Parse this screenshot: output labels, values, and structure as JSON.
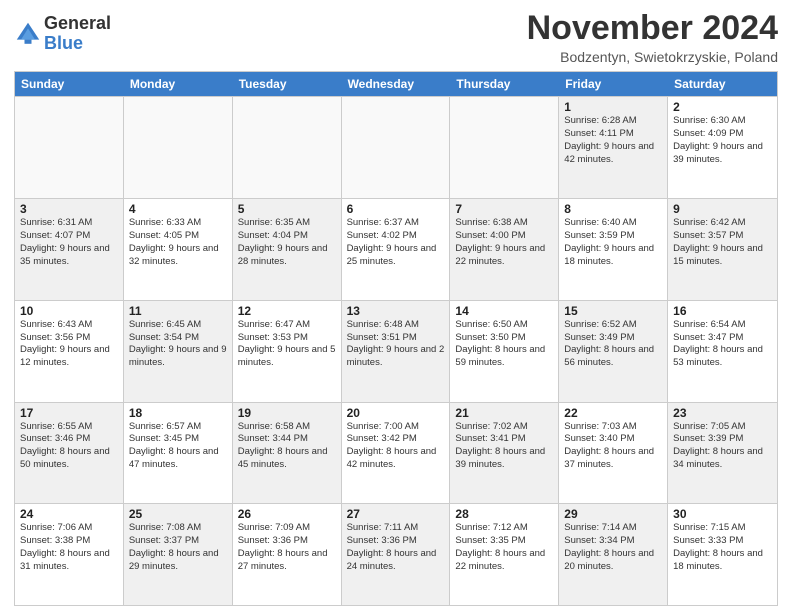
{
  "logo": {
    "general": "General",
    "blue": "Blue"
  },
  "title": "November 2024",
  "location": "Bodzentyn, Swietokrzyskie, Poland",
  "days_header": [
    "Sunday",
    "Monday",
    "Tuesday",
    "Wednesday",
    "Thursday",
    "Friday",
    "Saturday"
  ],
  "weeks": [
    [
      {
        "day": "",
        "info": "",
        "empty": true
      },
      {
        "day": "",
        "info": "",
        "empty": true
      },
      {
        "day": "",
        "info": "",
        "empty": true
      },
      {
        "day": "",
        "info": "",
        "empty": true
      },
      {
        "day": "",
        "info": "",
        "empty": true
      },
      {
        "day": "1",
        "info": "Sunrise: 6:28 AM\nSunset: 4:11 PM\nDaylight: 9 hours\nand 42 minutes.",
        "shaded": true
      },
      {
        "day": "2",
        "info": "Sunrise: 6:30 AM\nSunset: 4:09 PM\nDaylight: 9 hours\nand 39 minutes.",
        "shaded": false
      }
    ],
    [
      {
        "day": "3",
        "info": "Sunrise: 6:31 AM\nSunset: 4:07 PM\nDaylight: 9 hours\nand 35 minutes.",
        "shaded": true
      },
      {
        "day": "4",
        "info": "Sunrise: 6:33 AM\nSunset: 4:05 PM\nDaylight: 9 hours\nand 32 minutes.",
        "shaded": false
      },
      {
        "day": "5",
        "info": "Sunrise: 6:35 AM\nSunset: 4:04 PM\nDaylight: 9 hours\nand 28 minutes.",
        "shaded": true
      },
      {
        "day": "6",
        "info": "Sunrise: 6:37 AM\nSunset: 4:02 PM\nDaylight: 9 hours\nand 25 minutes.",
        "shaded": false
      },
      {
        "day": "7",
        "info": "Sunrise: 6:38 AM\nSunset: 4:00 PM\nDaylight: 9 hours\nand 22 minutes.",
        "shaded": true
      },
      {
        "day": "8",
        "info": "Sunrise: 6:40 AM\nSunset: 3:59 PM\nDaylight: 9 hours\nand 18 minutes.",
        "shaded": false
      },
      {
        "day": "9",
        "info": "Sunrise: 6:42 AM\nSunset: 3:57 PM\nDaylight: 9 hours\nand 15 minutes.",
        "shaded": true
      }
    ],
    [
      {
        "day": "10",
        "info": "Sunrise: 6:43 AM\nSunset: 3:56 PM\nDaylight: 9 hours\nand 12 minutes.",
        "shaded": false
      },
      {
        "day": "11",
        "info": "Sunrise: 6:45 AM\nSunset: 3:54 PM\nDaylight: 9 hours\nand 9 minutes.",
        "shaded": true
      },
      {
        "day": "12",
        "info": "Sunrise: 6:47 AM\nSunset: 3:53 PM\nDaylight: 9 hours\nand 5 minutes.",
        "shaded": false
      },
      {
        "day": "13",
        "info": "Sunrise: 6:48 AM\nSunset: 3:51 PM\nDaylight: 9 hours\nand 2 minutes.",
        "shaded": true
      },
      {
        "day": "14",
        "info": "Sunrise: 6:50 AM\nSunset: 3:50 PM\nDaylight: 8 hours\nand 59 minutes.",
        "shaded": false
      },
      {
        "day": "15",
        "info": "Sunrise: 6:52 AM\nSunset: 3:49 PM\nDaylight: 8 hours\nand 56 minutes.",
        "shaded": true
      },
      {
        "day": "16",
        "info": "Sunrise: 6:54 AM\nSunset: 3:47 PM\nDaylight: 8 hours\nand 53 minutes.",
        "shaded": false
      }
    ],
    [
      {
        "day": "17",
        "info": "Sunrise: 6:55 AM\nSunset: 3:46 PM\nDaylight: 8 hours\nand 50 minutes.",
        "shaded": true
      },
      {
        "day": "18",
        "info": "Sunrise: 6:57 AM\nSunset: 3:45 PM\nDaylight: 8 hours\nand 47 minutes.",
        "shaded": false
      },
      {
        "day": "19",
        "info": "Sunrise: 6:58 AM\nSunset: 3:44 PM\nDaylight: 8 hours\nand 45 minutes.",
        "shaded": true
      },
      {
        "day": "20",
        "info": "Sunrise: 7:00 AM\nSunset: 3:42 PM\nDaylight: 8 hours\nand 42 minutes.",
        "shaded": false
      },
      {
        "day": "21",
        "info": "Sunrise: 7:02 AM\nSunset: 3:41 PM\nDaylight: 8 hours\nand 39 minutes.",
        "shaded": true
      },
      {
        "day": "22",
        "info": "Sunrise: 7:03 AM\nSunset: 3:40 PM\nDaylight: 8 hours\nand 37 minutes.",
        "shaded": false
      },
      {
        "day": "23",
        "info": "Sunrise: 7:05 AM\nSunset: 3:39 PM\nDaylight: 8 hours\nand 34 minutes.",
        "shaded": true
      }
    ],
    [
      {
        "day": "24",
        "info": "Sunrise: 7:06 AM\nSunset: 3:38 PM\nDaylight: 8 hours\nand 31 minutes.",
        "shaded": false
      },
      {
        "day": "25",
        "info": "Sunrise: 7:08 AM\nSunset: 3:37 PM\nDaylight: 8 hours\nand 29 minutes.",
        "shaded": true
      },
      {
        "day": "26",
        "info": "Sunrise: 7:09 AM\nSunset: 3:36 PM\nDaylight: 8 hours\nand 27 minutes.",
        "shaded": false
      },
      {
        "day": "27",
        "info": "Sunrise: 7:11 AM\nSunset: 3:36 PM\nDaylight: 8 hours\nand 24 minutes.",
        "shaded": true
      },
      {
        "day": "28",
        "info": "Sunrise: 7:12 AM\nSunset: 3:35 PM\nDaylight: 8 hours\nand 22 minutes.",
        "shaded": false
      },
      {
        "day": "29",
        "info": "Sunrise: 7:14 AM\nSunset: 3:34 PM\nDaylight: 8 hours\nand 20 minutes.",
        "shaded": true
      },
      {
        "day": "30",
        "info": "Sunrise: 7:15 AM\nSunset: 3:33 PM\nDaylight: 8 hours\nand 18 minutes.",
        "shaded": false
      }
    ]
  ]
}
